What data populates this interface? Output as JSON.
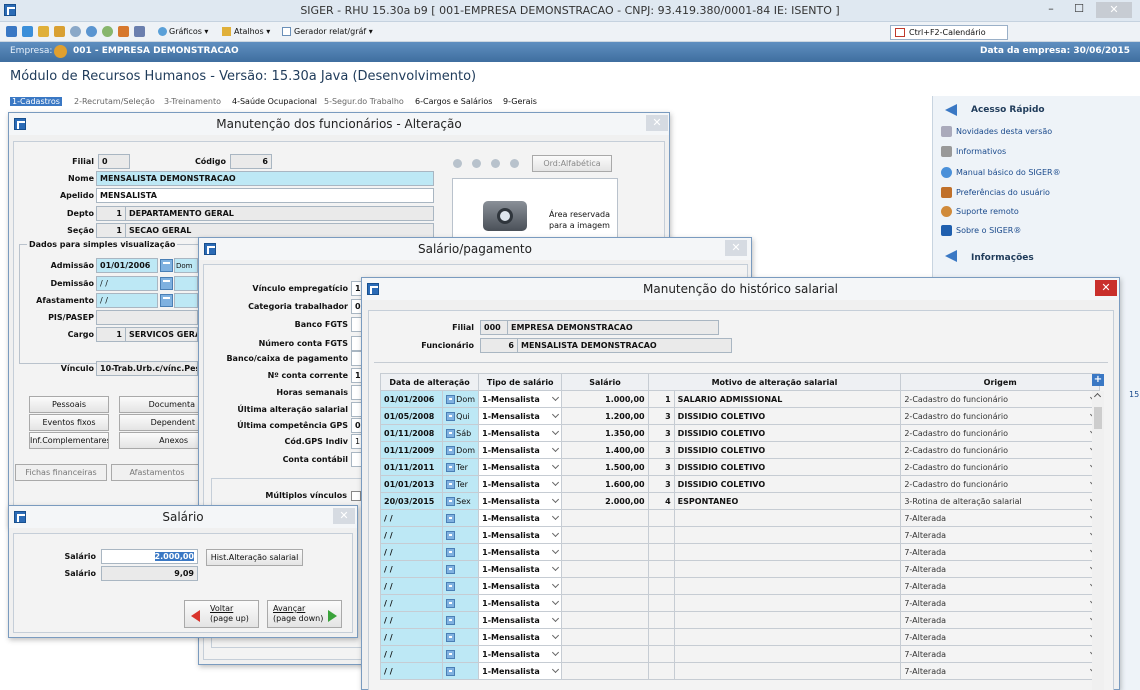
{
  "window": {
    "title": "SIGER - RHU 15.30a b9 [ 001-EMPRESA DEMONSTRACAO - CNPJ: 93.419.380/0001-84 IE: ISENTO ]",
    "min": "–",
    "max": "☐",
    "close": "✕"
  },
  "toolbar": {
    "graficos": "Gráficos ▾",
    "atalhos": "Atalhos ▾",
    "gerador": "Gerador relat/gráf ▾",
    "calendar_button": "Ctrl+F2-Calendário"
  },
  "company_bar": {
    "empresa_label": "Empresa:",
    "empresa_value": "001 - EMPRESA DEMONSTRACAO",
    "data_label": "Data da empresa: 30/06/2015"
  },
  "module_title": "Módulo de Recursos Humanos - Versão: 15.30a Java (Desenvolvimento)",
  "menu": [
    "1-Cadastros",
    "2-Recrutam/Seleção",
    "3-Treinamento",
    "4-Saúde Ocupacional",
    "5-Segur.do Trabalho",
    "6-Cargos e Salários",
    "9-Gerais"
  ],
  "quick_access": {
    "title": "Acesso Rápido",
    "items": [
      "Novidades desta versão",
      "Informativos",
      "Manual básico do SIGER®",
      "Preferências do usuário",
      "Suporte remoto",
      "Sobre o SIGER®"
    ],
    "info_title": "Informações",
    "side_number": "15"
  },
  "employee": {
    "title": "Manutenção dos funcionários - Alteração",
    "filial_label": "Filial",
    "filial": "0",
    "codigo_label": "Código",
    "codigo": "6",
    "nome_label": "Nome",
    "nome": "MENSALISTA DEMONSTRACAO",
    "apelido_label": "Apelido",
    "apelido": "MENSALISTA",
    "depto_label": "Depto",
    "depto_num": "1",
    "depto": "DEPARTAMENTO GERAL",
    "secao_label": "Seção",
    "secao_num": "1",
    "secao": "SECAO GERAL",
    "ord": "Ord:Alfabética",
    "image_area": "Área reservada para a imagem",
    "group_title": "Dados para simples visualização",
    "admissao_label": "Admissão",
    "admissao": "01/01/2006",
    "admissao_day": "Dom",
    "demissao_label": "Demissão",
    "demissao": " / /",
    "afastamento_label": "Afastamento",
    "afastamento": " / /",
    "pis_label": "PIS/PASEP",
    "cargo_label": "Cargo",
    "cargo_num": "1",
    "cargo": "SERVICOS GERA",
    "vinculo_label": "Vínculo",
    "vinculo": "10-Trab.Urb.c/vínc.Pes",
    "buttons": [
      "Pessoais",
      "Documenta",
      "Eventos fixos",
      "Dependent",
      "Inf.Complementares",
      "Anexos"
    ],
    "tabs": [
      "Fichas financeiras",
      "Afastamentos"
    ]
  },
  "payment": {
    "title": "Salário/pagamento",
    "labels": [
      "Vínculo empregatício",
      "Categoria trabalhador",
      "Banco FGTS",
      "Número conta FGTS",
      "Banco/caixa de pagamento",
      "Nº conta corrente",
      "Horas semanais",
      "Última alteração salarial",
      "Última competência GPS",
      "Cód.GPS Indiv",
      "Conta contábil"
    ],
    "values": [
      "1",
      "0",
      "",
      "",
      "",
      "1",
      "",
      "",
      "0",
      "1",
      ""
    ],
    "multiplos": "Múltiplos vínculos"
  },
  "salary": {
    "title": "Salário",
    "salario_label": "Salário",
    "salario": "2.000,00",
    "salario2_label": "Salário",
    "salario2": "9,09",
    "hist_button": "Hist.Alteração salarial",
    "voltar": "Voltar",
    "voltar_sub": "(page up)",
    "avancar": "Avançar",
    "avancar_sub": "(page down)"
  },
  "history": {
    "title": "Manutenção do histórico salarial",
    "filial_label": "Filial",
    "filial_num": "000",
    "filial": "EMPRESA DEMONSTRACAO",
    "func_label": "Funcionário",
    "func_num": "6",
    "func": "MENSALISTA DEMONSTRACAO",
    "headers": [
      "Data de alteração",
      "Tipo de salário",
      "Salário",
      "Motivo de alteração salarial",
      "Origem"
    ],
    "rows": [
      {
        "date": "01/01/2006",
        "day": "Dom",
        "tipo": "1-Mensalista",
        "salario": "1.000,00",
        "num": "1",
        "motivo": "SALARIO ADMISSIONAL",
        "origem": "2-Cadastro do funcionário"
      },
      {
        "date": "01/05/2008",
        "day": "Qui",
        "tipo": "1-Mensalista",
        "salario": "1.200,00",
        "num": "3",
        "motivo": "DISSIDIO COLETIVO",
        "origem": "2-Cadastro do funcionário"
      },
      {
        "date": "01/11/2008",
        "day": "Sáb",
        "tipo": "1-Mensalista",
        "salario": "1.350,00",
        "num": "3",
        "motivo": "DISSIDIO COLETIVO",
        "origem": "2-Cadastro do funcionário"
      },
      {
        "date": "01/11/2009",
        "day": "Dom",
        "tipo": "1-Mensalista",
        "salario": "1.400,00",
        "num": "3",
        "motivo": "DISSIDIO COLETIVO",
        "origem": "2-Cadastro do funcionário"
      },
      {
        "date": "01/11/2011",
        "day": "Ter",
        "tipo": "1-Mensalista",
        "salario": "1.500,00",
        "num": "3",
        "motivo": "DISSIDIO COLETIVO",
        "origem": "2-Cadastro do funcionário"
      },
      {
        "date": "01/01/2013",
        "day": "Ter",
        "tipo": "1-Mensalista",
        "salario": "1.600,00",
        "num": "3",
        "motivo": "DISSIDIO COLETIVO",
        "origem": "2-Cadastro do funcionário"
      },
      {
        "date": "20/03/2015",
        "day": "Sex",
        "tipo": "1-Mensalista",
        "salario": "2.000,00",
        "num": "4",
        "motivo": "ESPONTANEO",
        "origem": "3-Rotina de alteração salarial"
      },
      {
        "date": " / /",
        "day": "",
        "tipo": "1-Mensalista",
        "salario": "",
        "num": "",
        "motivo": "",
        "origem": "7-Alterada"
      },
      {
        "date": " / /",
        "day": "",
        "tipo": "1-Mensalista",
        "salario": "",
        "num": "",
        "motivo": "",
        "origem": "7-Alterada"
      },
      {
        "date": " / /",
        "day": "",
        "tipo": "1-Mensalista",
        "salario": "",
        "num": "",
        "motivo": "",
        "origem": "7-Alterada"
      },
      {
        "date": " / /",
        "day": "",
        "tipo": "1-Mensalista",
        "salario": "",
        "num": "",
        "motivo": "",
        "origem": "7-Alterada"
      },
      {
        "date": " / /",
        "day": "",
        "tipo": "1-Mensalista",
        "salario": "",
        "num": "",
        "motivo": "",
        "origem": "7-Alterada"
      },
      {
        "date": " / /",
        "day": "",
        "tipo": "1-Mensalista",
        "salario": "",
        "num": "",
        "motivo": "",
        "origem": "7-Alterada"
      },
      {
        "date": " / /",
        "day": "",
        "tipo": "1-Mensalista",
        "salario": "",
        "num": "",
        "motivo": "",
        "origem": "7-Alterada"
      },
      {
        "date": " / /",
        "day": "",
        "tipo": "1-Mensalista",
        "salario": "",
        "num": "",
        "motivo": "",
        "origem": "7-Alterada"
      },
      {
        "date": " / /",
        "day": "",
        "tipo": "1-Mensalista",
        "salario": "",
        "num": "",
        "motivo": "",
        "origem": "7-Alterada"
      },
      {
        "date": " / /",
        "day": "",
        "tipo": "1-Mensalista",
        "salario": "",
        "num": "",
        "motivo": "",
        "origem": "7-Alterada"
      }
    ]
  }
}
